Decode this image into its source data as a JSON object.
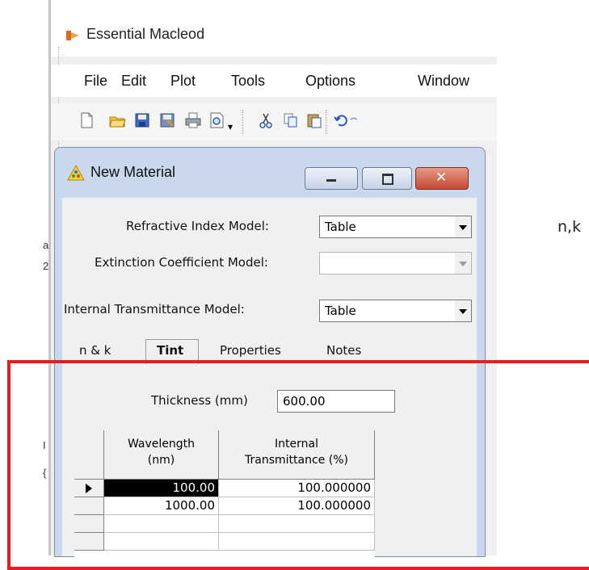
{
  "app": {
    "title": "Essential Macleod",
    "icon": "macleod-app-icon"
  },
  "menu": [
    "File",
    "Edit",
    "Plot",
    "Tools",
    "Options",
    "Window"
  ],
  "toolbar": {
    "icons": [
      "new-document-icon",
      "open-folder-icon",
      "save-icon",
      "save-as-icon",
      "print-icon",
      "print-preview-icon",
      "cut-icon",
      "copy-icon",
      "paste-icon",
      "undo-icon",
      "redo-icon"
    ]
  },
  "dialog": {
    "title": "New Material",
    "icon": "warning-material-icon",
    "buttons": [
      "minimize-button",
      "maximize-button",
      "close-button"
    ],
    "fields": {
      "refractive_label": "Refractive Index Model:",
      "refractive_value": "Table",
      "extinction_label": "Extinction Coefficient Model:",
      "extinction_value": "",
      "transmittance_label": "Internal Transmittance Model:",
      "transmittance_value": "Table"
    },
    "tabs": [
      "n & k",
      "Tint",
      "Properties",
      "Notes"
    ],
    "active_tab": "Tint",
    "thickness_label": "Thickness (mm)",
    "thickness_value": "600.00",
    "grid": {
      "headers": [
        [
          "Wavelength",
          "(nm)"
        ],
        [
          "Internal",
          "Transmittance (%)"
        ]
      ],
      "rows": [
        [
          "100.00",
          "100.000000"
        ],
        [
          "1000.00",
          "100.000000"
        ],
        [
          "",
          ""
        ],
        [
          "",
          ""
        ]
      ],
      "selected_row": 0
    }
  },
  "side_text": "n,k",
  "colors": {
    "highlight": "#ec1c1c",
    "dialog_frame": "#c9d8ec"
  }
}
